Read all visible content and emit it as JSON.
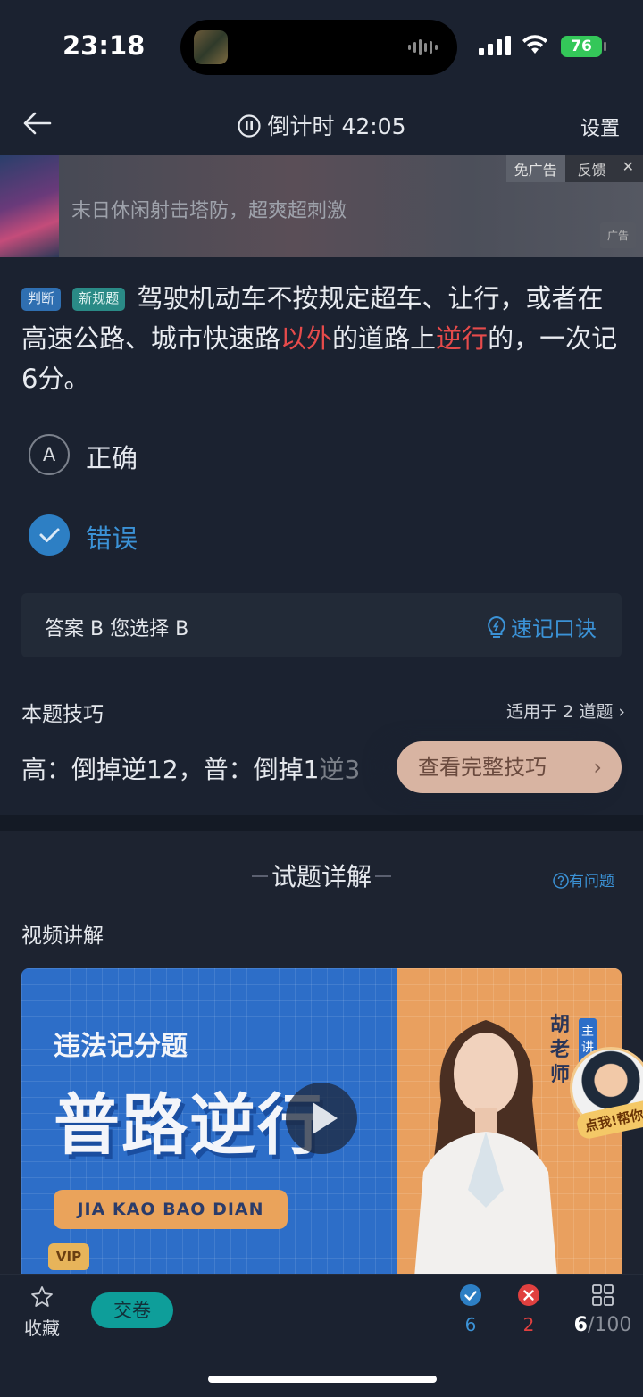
{
  "status_bar": {
    "time": "23:18",
    "battery": "76"
  },
  "nav": {
    "countdown": "倒计时 42:05",
    "settings": "设置"
  },
  "ad": {
    "text": "末日休闲射击塔防，超爽超刺激",
    "no_ads": "免广告",
    "feedback": "反馈",
    "close": "✕",
    "tag": "广告"
  },
  "question": {
    "tag_type": "判断",
    "tag_new": "新规题",
    "text_1": "驾驶机动车不按规定超车、让行，或者在高速公路、城市快速路",
    "highlight_1": "以外",
    "text_2": "的道路上",
    "highlight_2": "逆行",
    "text_3": "的，一次记6分。"
  },
  "options": [
    {
      "letter": "A",
      "label": "正确"
    },
    {
      "letter": "",
      "label": "错误"
    }
  ],
  "answer": {
    "text": "答案 B 您选择 B",
    "mnemonic": "速记口诀"
  },
  "tips": {
    "title": "本题技巧",
    "applies": "适用于 2 道题",
    "line_visible": "高：倒掉逆12，普：倒掉1",
    "line_faded": "逆3",
    "button": "查看完整技巧"
  },
  "detail": {
    "title": "试题详解",
    "question_link": "有问题",
    "video_label": "视频讲解"
  },
  "video": {
    "subtitle": "违法记分题",
    "title": "普路逆行",
    "pill": "JIA KAO BAO DIAN",
    "vip": "VIP",
    "teacher": "胡老师",
    "host_tag": "主讲"
  },
  "help": {
    "label": "点我!帮你讲"
  },
  "bottom_bar": {
    "favorite": "收藏",
    "submit": "交卷",
    "correct_count": "6",
    "wrong_count": "2",
    "current": "6",
    "total": "/100"
  },
  "colors": {
    "accent_blue": "#2d7fc4",
    "highlight_red": "#e64b4b",
    "correct_blue": "#3b92d6",
    "wrong_red": "#e0403f"
  }
}
